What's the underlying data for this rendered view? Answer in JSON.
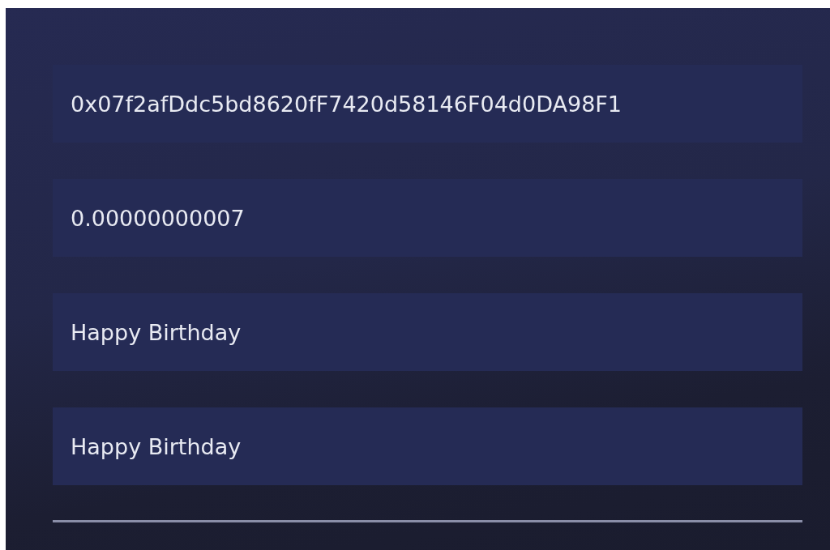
{
  "fields": [
    {
      "value": "0x07f2afDdc5bd8620fF7420d58146F04d0DA98F1"
    },
    {
      "value": "0.00000000007"
    },
    {
      "value": "Happy Birthday"
    },
    {
      "value": "Happy Birthday"
    }
  ]
}
